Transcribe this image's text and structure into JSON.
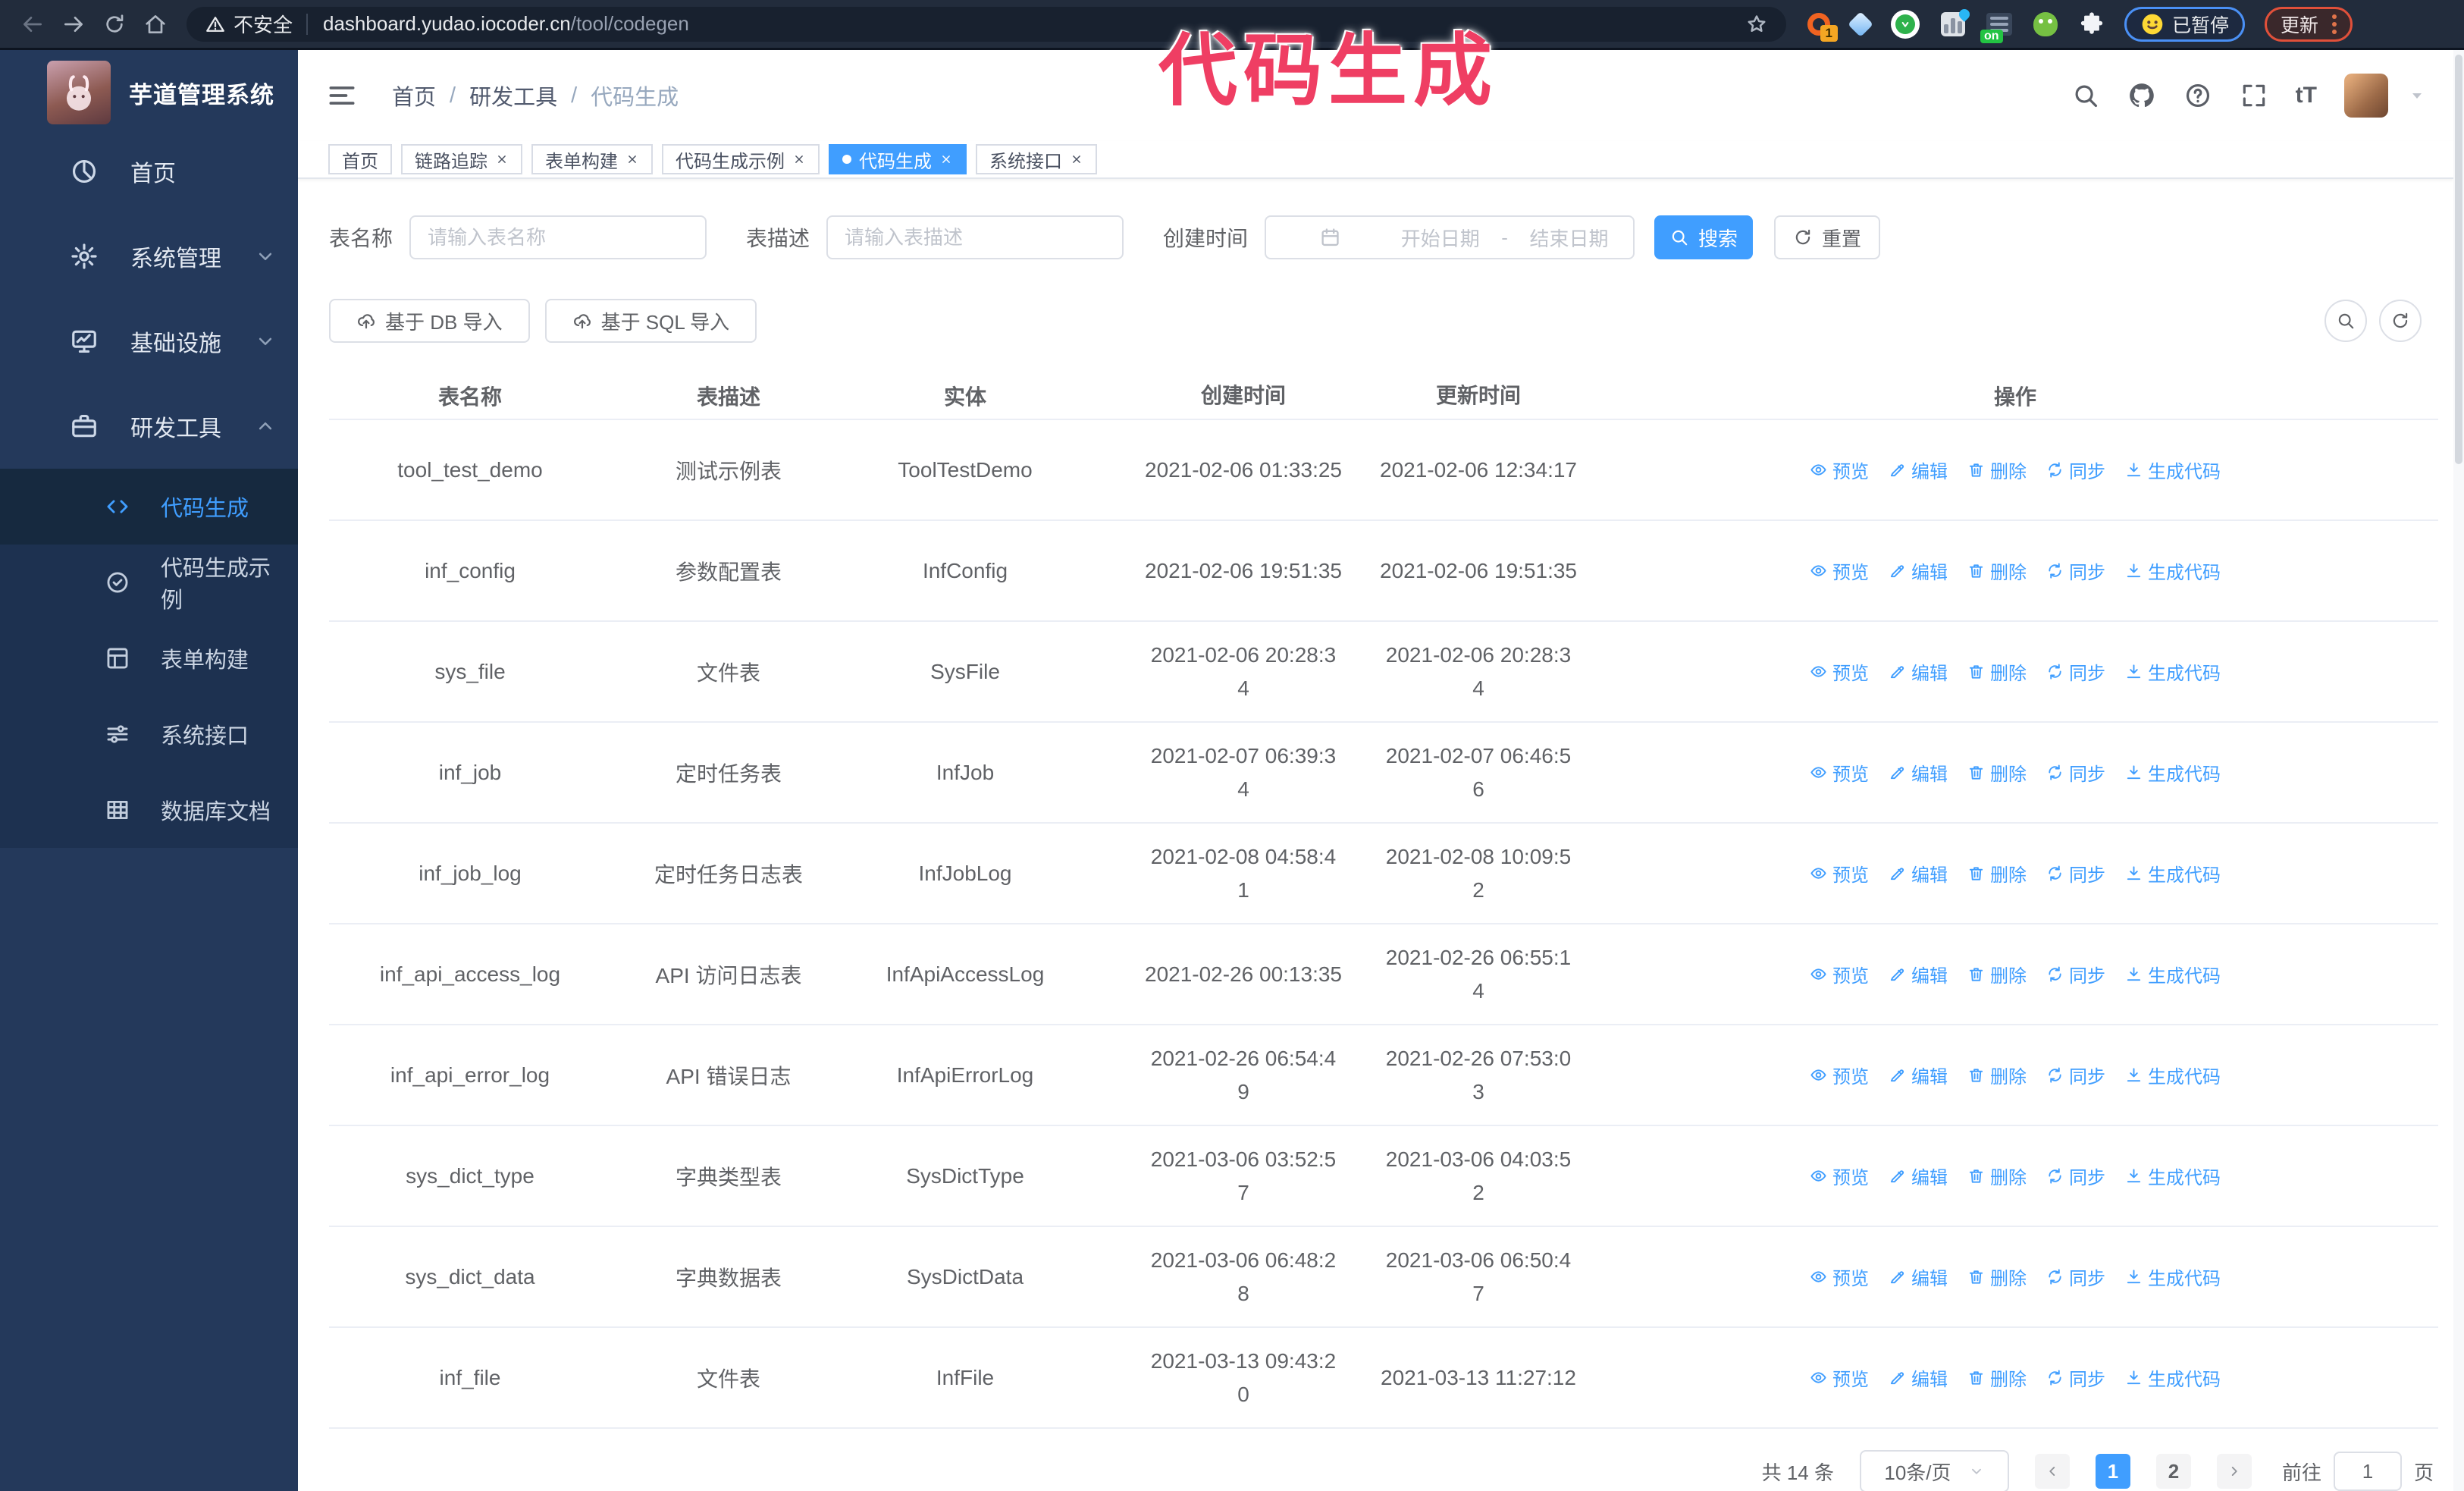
{
  "colors": {
    "accent": "#409eff",
    "annotation": "#ef3e63",
    "sidebar": "#24395b",
    "active_tab": "#409eff"
  },
  "annotation": {
    "text": "代码生成"
  },
  "browser": {
    "security_label": "不安全",
    "url_host": "dashboard.yudao.iocoder.cn",
    "url_path": "/tool/codegen",
    "extension_badge": "1",
    "on_badge": "on",
    "paused_label": "已暂停",
    "update_label": "更新"
  },
  "sidebar": {
    "title": "芋道管理系统",
    "items": [
      {
        "label": "首页",
        "icon": "dashboard",
        "chevron": ""
      },
      {
        "label": "系统管理",
        "icon": "gear",
        "chevron": "down"
      },
      {
        "label": "基础设施",
        "icon": "infra",
        "chevron": "down"
      },
      {
        "label": "研发工具",
        "icon": "tools",
        "chevron": "up"
      }
    ],
    "submenu": [
      {
        "label": "代码生成",
        "icon": "code",
        "active": true
      },
      {
        "label": "代码生成示例",
        "icon": "example",
        "active": false
      },
      {
        "label": "表单构建",
        "icon": "form",
        "active": false
      },
      {
        "label": "系统接口",
        "icon": "api",
        "active": false
      },
      {
        "label": "数据库文档",
        "icon": "dbdoc",
        "active": false
      }
    ]
  },
  "header": {
    "breadcrumb": [
      "首页",
      "研发工具",
      "代码生成"
    ],
    "separator": "/"
  },
  "tabs": [
    {
      "label": "首页",
      "closable": false,
      "active": false
    },
    {
      "label": "链路追踪",
      "closable": true,
      "active": false
    },
    {
      "label": "表单构建",
      "closable": true,
      "active": false
    },
    {
      "label": "代码生成示例",
      "closable": true,
      "active": false
    },
    {
      "label": "代码生成",
      "closable": true,
      "active": true
    },
    {
      "label": "系统接口",
      "closable": true,
      "active": false
    }
  ],
  "filters": {
    "table_name_label": "表名称",
    "table_name_placeholder": "请输入表名称",
    "table_desc_label": "表描述",
    "table_desc_placeholder": "请输入表描述",
    "create_time_label": "创建时间",
    "start_placeholder": "开始日期",
    "range_separator": "-",
    "end_placeholder": "结束日期",
    "search_label": "搜索",
    "reset_label": "重置"
  },
  "toolbar": {
    "import_db_label": "基于 DB 导入",
    "import_sql_label": "基于 SQL 导入"
  },
  "table": {
    "columns": [
      "表名称",
      "表描述",
      "实体",
      "创建时间",
      "更新时间",
      "操作"
    ],
    "actions": [
      "预览",
      "编辑",
      "删除",
      "同步",
      "生成代码"
    ],
    "rows": [
      {
        "name": "tool_test_demo",
        "desc": "测试示例表",
        "entity": "ToolTestDemo",
        "created": "2021-02-06 01:33:25",
        "updated": "2021-02-06 12:34:17"
      },
      {
        "name": "inf_config",
        "desc": "参数配置表",
        "entity": "InfConfig",
        "created": "2021-02-06 19:51:35",
        "updated": "2021-02-06 19:51:35"
      },
      {
        "name": "sys_file",
        "desc": "文件表",
        "entity": "SysFile",
        "created": "2021-02-06 20:28:3\n4",
        "updated": "2021-02-06 20:28:3\n4"
      },
      {
        "name": "inf_job",
        "desc": "定时任务表",
        "entity": "InfJob",
        "created": "2021-02-07 06:39:3\n4",
        "updated": "2021-02-07 06:46:5\n6"
      },
      {
        "name": "inf_job_log",
        "desc": "定时任务日志表",
        "entity": "InfJobLog",
        "created": "2021-02-08 04:58:4\n1",
        "updated": "2021-02-08 10:09:5\n2"
      },
      {
        "name": "inf_api_access_log",
        "desc": "API 访问日志表",
        "entity": "InfApiAccessLog",
        "created": "2021-02-26 00:13:35",
        "updated": "2021-02-26 06:55:1\n4"
      },
      {
        "name": "inf_api_error_log",
        "desc": "API 错误日志",
        "entity": "InfApiErrorLog",
        "created": "2021-02-26 06:54:4\n9",
        "updated": "2021-02-26 07:53:0\n3"
      },
      {
        "name": "sys_dict_type",
        "desc": "字典类型表",
        "entity": "SysDictType",
        "created": "2021-03-06 03:52:5\n7",
        "updated": "2021-03-06 04:03:5\n2"
      },
      {
        "name": "sys_dict_data",
        "desc": "字典数据表",
        "entity": "SysDictData",
        "created": "2021-03-06 06:48:2\n8",
        "updated": "2021-03-06 06:50:4\n7"
      },
      {
        "name": "inf_file",
        "desc": "文件表",
        "entity": "InfFile",
        "created": "2021-03-13 09:43:2\n0",
        "updated": "2021-03-13 11:27:12"
      }
    ]
  },
  "pagination": {
    "total_label": "共 14 条",
    "page_size_label": "10条/页",
    "pages": [
      "1",
      "2"
    ],
    "active_page": "1",
    "goto_label": "前往",
    "goto_value": "1",
    "page_unit_label": "页"
  }
}
